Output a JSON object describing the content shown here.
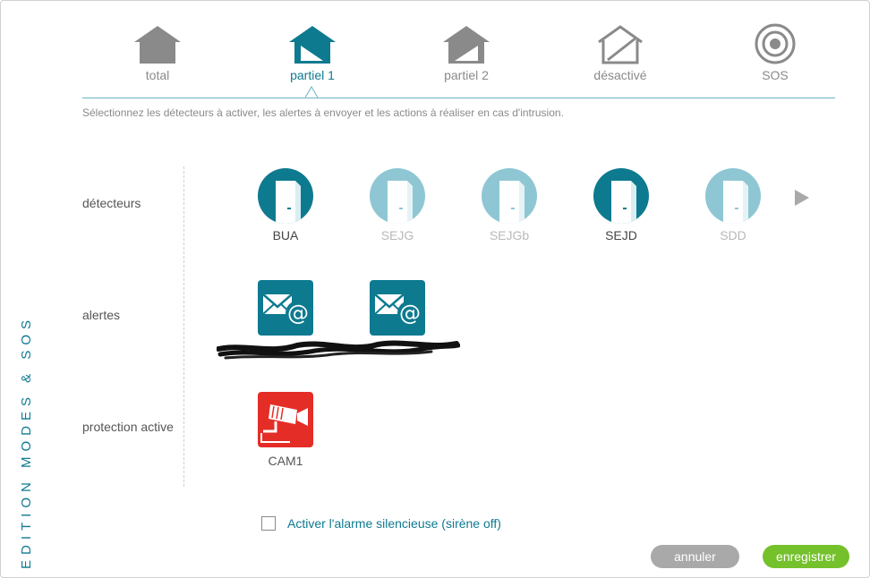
{
  "side_title": "EDITION MODES & SOS",
  "modes": [
    {
      "label": "total",
      "icon": "house-icon",
      "active": false
    },
    {
      "label": "partiel 1",
      "icon": "house-partial-1-icon",
      "active": true
    },
    {
      "label": "partiel 2",
      "icon": "house-partial-2-icon",
      "active": false
    },
    {
      "label": "désactivé",
      "icon": "house-outline-icon",
      "active": false
    },
    {
      "label": "SOS",
      "icon": "target-icon",
      "active": false
    }
  ],
  "instructions": "Sélectionnez les détecteurs à activer, les alertes à envoyer et les actions à réaliser en cas d'intrusion.",
  "rows": {
    "detectors_label": "détecteurs",
    "alerts_label": "alertes",
    "protection_label": "protection active"
  },
  "detectors": [
    {
      "label": "BUA",
      "active": true,
      "icon": "door-icon"
    },
    {
      "label": "SEJG",
      "active": false,
      "icon": "door-icon"
    },
    {
      "label": "SEJGb",
      "active": false,
      "icon": "door-icon"
    },
    {
      "label": "SEJD",
      "active": true,
      "icon": "door-icon"
    },
    {
      "label": "SDD",
      "active": false,
      "icon": "door-icon"
    }
  ],
  "alerts": [
    {
      "icon": "email-at-icon"
    },
    {
      "icon": "email-at-icon"
    }
  ],
  "protection": [
    {
      "label": "CAM1",
      "icon": "camera-icon"
    }
  ],
  "silent_alarm": {
    "label": "Activer l'alarme silencieuse (sirène off)",
    "checked": false
  },
  "buttons": {
    "cancel": "annuler",
    "save": "enregistrer"
  },
  "colors": {
    "teal": "#0e7a90",
    "teal_light": "#8ec7d3",
    "grey": "#8a8a8a",
    "red": "#e52d27",
    "green": "#74c12b"
  }
}
